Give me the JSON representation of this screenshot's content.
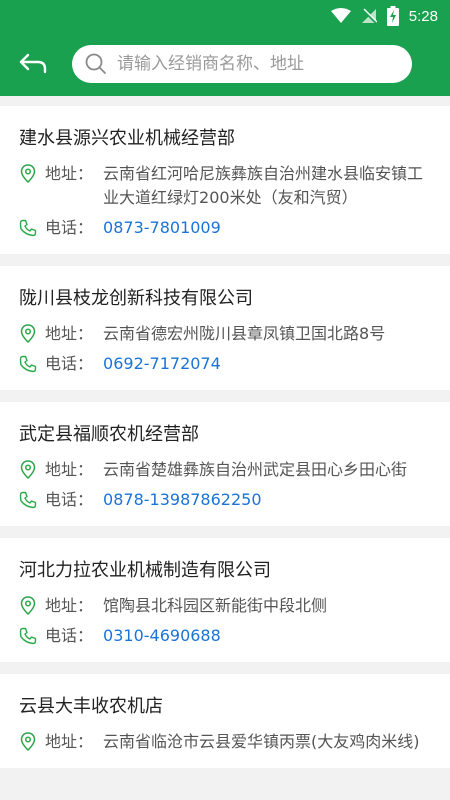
{
  "status_bar": {
    "time": "5:28"
  },
  "search": {
    "placeholder": "请输入经销商名称、地址"
  },
  "labels": {
    "address": "地址",
    "phone": "电话"
  },
  "dealers": [
    {
      "name": "建水县源兴农业机械经营部",
      "address": "云南省红河哈尼族彝族自治州建水县临安镇工业大道红绿灯200米处（友和汽贸）",
      "phone": "0873-7801009"
    },
    {
      "name": "陇川县枝龙创新科技有限公司",
      "address": "云南省德宏州陇川县章凤镇卫国北路8号",
      "phone": "0692-7172074"
    },
    {
      "name": "武定县福顺农机经营部",
      "address": "云南省楚雄彝族自治州武定县田心乡田心街",
      "phone": "0878-13987862250"
    },
    {
      "name": "河北力拉农业机械制造有限公司",
      "address": "馆陶县北科园区新能街中段北侧",
      "phone": "0310-4690688"
    },
    {
      "name": "云县大丰收农机店",
      "address": "云南省临沧市云县爱华镇丙票(大友鸡肉米线)",
      "phone": ""
    }
  ],
  "colors": {
    "primary": "#1aa14f",
    "link": "#1a73d6"
  }
}
